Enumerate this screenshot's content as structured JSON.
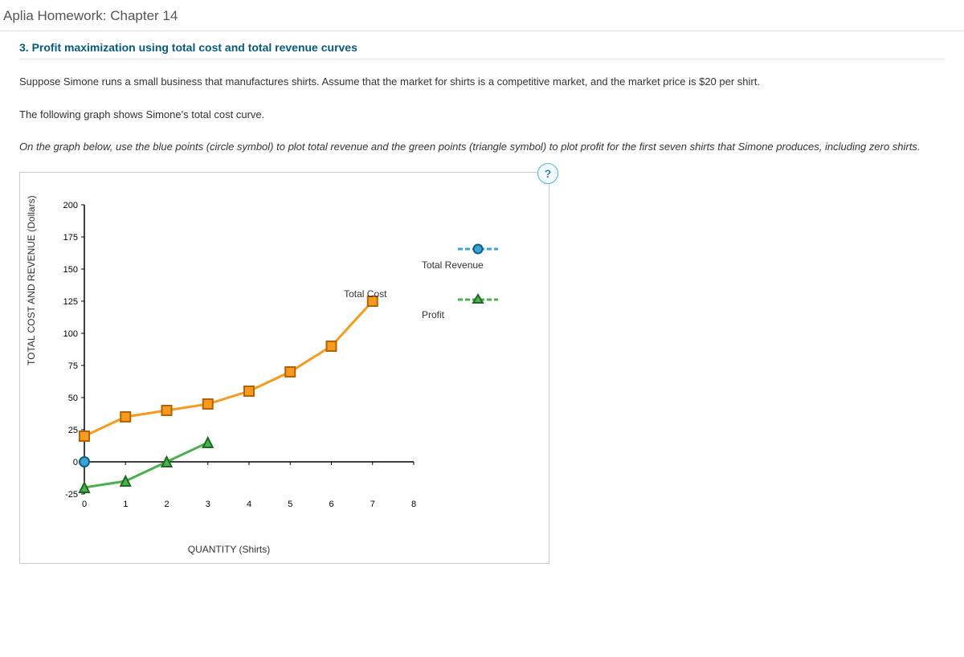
{
  "header": {
    "title": "Aplia Homework: Chapter 14"
  },
  "question": {
    "title": "3. Profit maximization using total cost and total revenue curves",
    "para1": "Suppose Simone runs a small business that manufactures shirts. Assume that the market for shirts is a competitive market, and the market price is $20 per shirt.",
    "para2": "The following graph shows Simone's total cost curve.",
    "instructions": "On the graph below, use the blue points (circle symbol) to plot total revenue and the green points (triangle symbol) to plot profit for the first seven shirts that Simone produces, including zero shirts."
  },
  "help": {
    "label": "?"
  },
  "chart_data": {
    "type": "line",
    "xlabel": "QUANTITY (Shirts)",
    "ylabel": "TOTAL COST AND REVENUE (Dollars)",
    "xlim": [
      0,
      8
    ],
    "ylim": [
      -25,
      200
    ],
    "xticks": [
      0,
      1,
      2,
      3,
      4,
      5,
      6,
      7,
      8
    ],
    "yticks": [
      -25,
      0,
      25,
      50,
      75,
      100,
      125,
      150,
      175,
      200
    ],
    "series": [
      {
        "name": "Total Cost",
        "symbol": "square",
        "color": "#f79b1e",
        "x": [
          0,
          1,
          2,
          3,
          4,
          5,
          6,
          7
        ],
        "y": [
          20,
          35,
          40,
          45,
          55,
          70,
          90,
          125
        ]
      },
      {
        "name": "Total Revenue",
        "symbol": "circle",
        "color": "#3da3d4",
        "x": [
          0
        ],
        "y": [
          0
        ]
      },
      {
        "name": "Profit",
        "symbol": "triangle",
        "color": "#4caf50",
        "x": [
          0,
          1,
          2,
          3
        ],
        "y": [
          -20,
          -15,
          0,
          15
        ]
      }
    ],
    "legend": [
      {
        "name": "Total Revenue",
        "symbol": "circle",
        "color": "#3da3d4"
      },
      {
        "name": "Profit",
        "symbol": "triangle",
        "color": "#4caf50"
      }
    ],
    "inline_label": {
      "text": "Total Cost",
      "x": 6.5,
      "y": 130
    }
  }
}
